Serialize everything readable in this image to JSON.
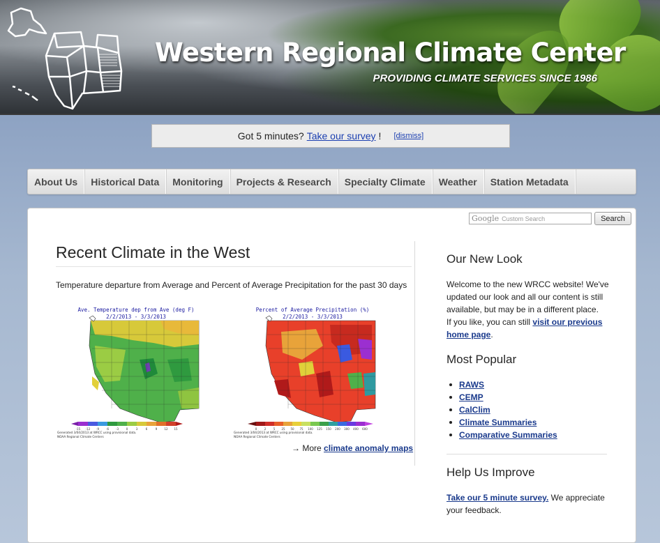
{
  "banner": {
    "title": "Western Regional Climate Center",
    "subtitle": "PROVIDING CLIMATE SERVICES SINCE 1986"
  },
  "survey": {
    "prompt": "Got 5 minutes?",
    "link": "Take our survey",
    "after": "!",
    "dismiss": "[dismiss]"
  },
  "nav": {
    "items": [
      "About Us",
      "Historical Data",
      "Monitoring",
      "Projects & Research",
      "Specialty Climate",
      "Weather",
      "Station Metadata"
    ]
  },
  "search": {
    "google_label": "Google",
    "placeholder": "Custom Search",
    "button": "Search"
  },
  "main": {
    "title": "Recent Climate in the West",
    "intro": "Temperature departure from Average and Percent of Average Precipitation for the past 30 days",
    "temp_map": {
      "title": "Ave. Temperature dep from Ave (deg F)",
      "dates": "2/2/2013 - 3/3/2013",
      "legend_ticks": [
        "-15",
        "-12",
        "-9",
        "-6",
        "-3",
        "0",
        "3",
        "6",
        "9",
        "12",
        "15"
      ],
      "credit1": "Generated 3/04/2013 at WRCC using provisional data.",
      "credit2": "NOAA Regional Climate Centers"
    },
    "precip_map": {
      "title": "Percent of Average Precipitation (%)",
      "dates": "2/2/2013 - 3/3/2013",
      "legend_ticks": [
        "0",
        "2",
        "5",
        "25",
        "50",
        "75",
        "100",
        "125",
        "150",
        "200",
        "300",
        "400",
        "600"
      ],
      "credit1": "Generated 3/04/2013 at WRCC using provisional data.",
      "credit2": "NOAA Regional Climate Centers"
    },
    "more_prefix": "→ More ",
    "more_link": "climate anomaly maps"
  },
  "sidebar": {
    "new_look_title": "Our New Look",
    "new_look_text": "Welcome to the new WRCC website! We've updated our look and all our content is still available, but may be in a different place.",
    "new_look_text2": "If you like, you can still ",
    "new_look_link": "visit our previous home page",
    "new_look_end": ".",
    "popular_title": "Most Popular",
    "popular_items": [
      "RAWS",
      "CEMP",
      "CalClim",
      "Climate Summaries",
      "Comparative Summaries"
    ],
    "improve_title": "Help Us Improve",
    "improve_link": "Take our 5 minute survey.",
    "improve_text": " We appreciate your feedback."
  },
  "colors": {
    "link": "#1a3a8c",
    "survey_link": "#1a3eb0",
    "background": "#8ea3c3"
  }
}
